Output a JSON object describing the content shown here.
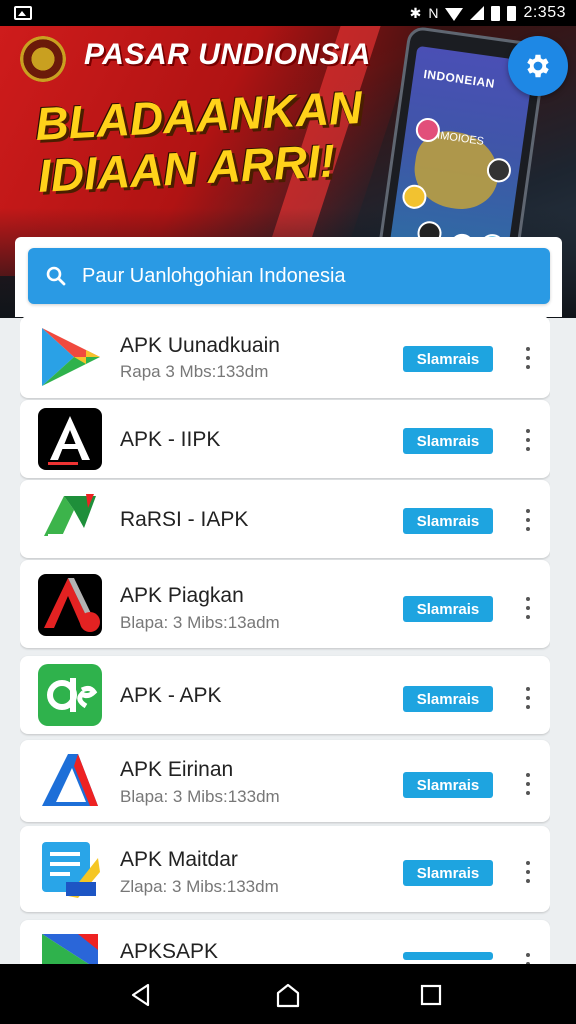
{
  "status_bar": {
    "time": "2:353",
    "icons": [
      "image-icon",
      "bluetooth-icon",
      "wifi-icon",
      "signal-icon",
      "battery-icon",
      "battery-icon"
    ]
  },
  "banner": {
    "brand": "PASAR UNDIONSIA",
    "headline_line1": "BLADAANKAN",
    "headline_line2": "IDIAAN ARRI!",
    "phone_title": "INDONEIAN",
    "phone_subtitle": "IMOIOES"
  },
  "search": {
    "placeholder": "Paur Uanlohgohian Indonesia"
  },
  "apps": [
    {
      "title": "APK Uunadkuain",
      "subtitle": "Rapa 3 Mbs:133dm",
      "button": "Slamrais"
    },
    {
      "title": "APK - IIPK",
      "subtitle": "",
      "button": "Slamrais"
    },
    {
      "title": "RaRSI - IAPK",
      "subtitle": "",
      "button": "Slamrais"
    },
    {
      "title": "APK Piagkan",
      "subtitle": "Blapa: 3 Mibs:13adm",
      "button": "Slamrais"
    },
    {
      "title": "APK - APK",
      "subtitle": "",
      "button": "Slamrais"
    },
    {
      "title": "APK Eirinan",
      "subtitle": "Blapa: 3 Mibs:133dm",
      "button": "Slamrais"
    },
    {
      "title": "APK Maitdar",
      "subtitle": "Zlapa: 3 Mibs:133dm",
      "button": "Slamrais"
    },
    {
      "title": "APKSAPK",
      "subtitle": "",
      "button": ""
    }
  ],
  "colors": {
    "accent": "#1ea4e0",
    "search_bg": "#2a9ae4",
    "fab": "#1e88e5",
    "banner_red": "#d31d1d",
    "headline_yellow": "#ffd21a"
  }
}
